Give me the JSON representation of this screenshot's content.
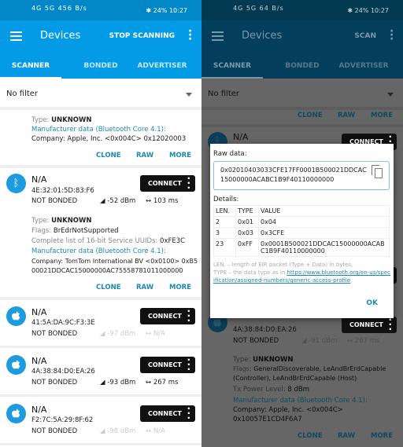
{
  "status": {
    "left": "4G 5G 456 B/s",
    "left_right": "4G 5G 64 B/s",
    "battery": "✱ 24%",
    "time": "10:27"
  },
  "left": {
    "title": "Devices",
    "action": "STOP SCANNING",
    "tabs": [
      "SCANNER",
      "BONDED",
      "ADVERTISER"
    ],
    "filter": "No filter",
    "card1": {
      "type_label": "Type:",
      "type": "UNKNOWN",
      "mfr": "Manufacturer data (Bluetooth Core 4.1):",
      "company": "Company: Apple, Inc. <0x004C> 0x12020003"
    },
    "actions": [
      "CLONE",
      "RAW",
      "MORE"
    ],
    "connect": "CONNECT",
    "card2": {
      "name": "N/A",
      "mac": "4E:32:01:5D:83:F6",
      "bond": "NOT BONDED",
      "rssi": "◢ -52 dBm",
      "interval": "↔ 103 ms",
      "type_label": "Type:",
      "type": "UNKNOWN",
      "flags_label": "Flags:",
      "flags": "BrEdrNotSupported",
      "uuids_label": "Complete list of 16-bit Service UUIDs:",
      "uuids": "0xFE3C",
      "mfr": "Manufacturer data (Bluetooth Core 4.1):",
      "company": "Company: TomTom International BV <0x0100> 0xB5",
      "company2": "00021DDCAC15000000AC75558781011000000"
    },
    "devices": [
      {
        "name": "N/A",
        "mac": "41:5A:DA:9C:F3:3E",
        "bond": "NOT BONDED",
        "rssi": "◢ -97 dBm",
        "interval": "↔ N/A",
        "dim": true
      },
      {
        "name": "N/A",
        "mac": "4A:38:84:D0:EA:26",
        "bond": "NOT BONDED",
        "rssi": "◢ -93 dBm",
        "interval": "↔ 267 ms",
        "dim": false
      },
      {
        "name": "N/A",
        "mac": "F2:7C:5A:29:8F:62",
        "bond": "NOT BONDED",
        "rssi": "◢ -98 dBm",
        "interval": "↔ N/A",
        "dim": true
      }
    ]
  },
  "right": {
    "title": "Devices",
    "action": "SCAN",
    "tabs": [
      "SCANNER",
      "BONDED",
      "ADVERTISER"
    ],
    "filter": "No filter",
    "top_name": "N/A",
    "bottom": {
      "mac": "4A:38:84:D0:EA:26",
      "bond": "NOT BONDED",
      "rssi": "◢ -91 dBm",
      "interval": "↔ 267 ms",
      "type_label": "Type:",
      "type": "UNKNOWN",
      "flags_label": "Flags:",
      "flags": "GeneralDiscoverable, LeAndBrErdCapable",
      "flags2": "(Controller), LeAndBrErdCapable (Host)",
      "tx_label": "Tx Power Level:",
      "tx": "8 dBm",
      "mfr": "Manufacturer data (Bluetooth Core 4.1):",
      "company": "Company: Apple, Inc. <0x004C>",
      "company2": "0x10057E1CD4F6A7"
    },
    "dialog": {
      "raw_label": "Raw data:",
      "raw": "0x02010403033CFE17FF0001B500021DDCAC15000000ACABC1B9F40110000000",
      "details_label": "Details:",
      "headers": [
        "LEN.",
        "TYPE",
        "VALUE"
      ],
      "rows": [
        [
          "2",
          "0x01",
          "0x04"
        ],
        [
          "3",
          "0x03",
          "0x3CFE"
        ],
        [
          "23",
          "0xFF",
          "0x0001B500021DDCAC15000000ACABC1B9F40110000000"
        ]
      ],
      "note1": "LEN. – length of EIR packet (Type + Data) in bytes,",
      "note2": "TYPE – the data type as in ",
      "link": "https://www.bluetooth.org/en-us/specification/assigned-numbers/generic-access-profile",
      "ok": "OK"
    }
  },
  "colors": {
    "primary": "#039be5",
    "accent": "#1e88b5"
  }
}
